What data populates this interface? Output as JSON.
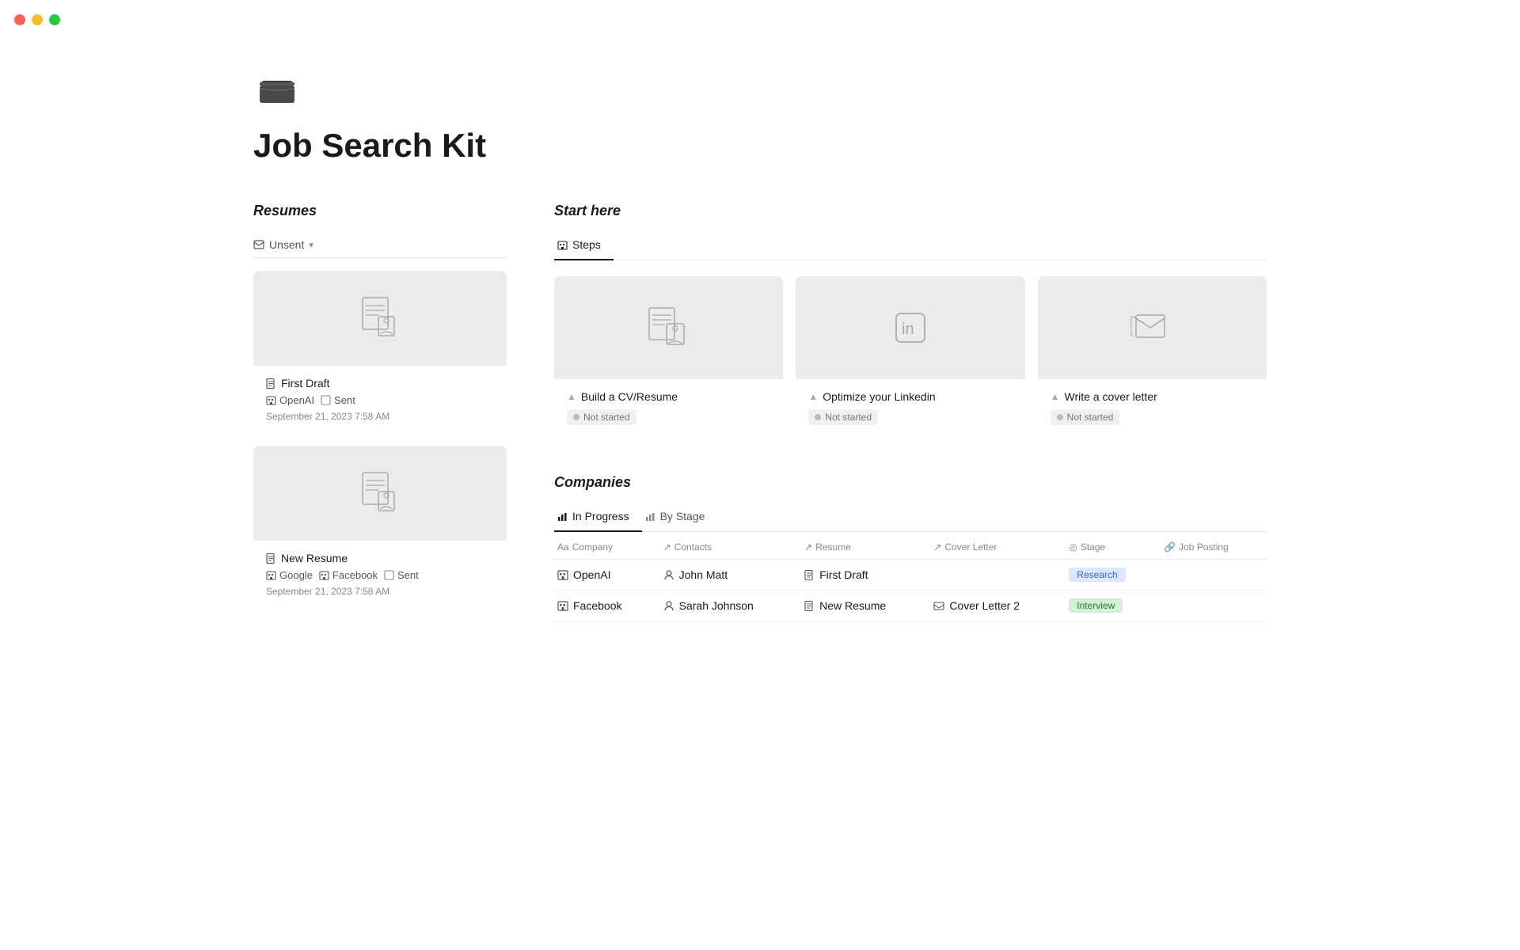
{
  "trafficLights": {
    "red": "#ff5f57",
    "yellow": "#febc2e",
    "green": "#28c840"
  },
  "page": {
    "title": "Job Search Kit"
  },
  "resumes": {
    "sectionHeader": "Resumes",
    "filter": {
      "label": "Unsent",
      "icon": "envelope-icon"
    },
    "cards": [
      {
        "title": "First Draft",
        "metaItems": [
          "OpenAI"
        ],
        "sent": "Sent",
        "date": "September 21, 2023 7:58 AM"
      },
      {
        "title": "New Resume",
        "metaItems": [
          "Google",
          "Facebook"
        ],
        "sent": "Sent",
        "date": "September 21, 2023 7:58 AM"
      }
    ]
  },
  "startHere": {
    "sectionHeader": "Start here",
    "tabs": [
      {
        "label": "Steps",
        "active": true
      }
    ],
    "steps": [
      {
        "title": "Build a CV/Resume",
        "status": "Not started"
      },
      {
        "title": "Optimize your Linkedin",
        "status": "Not started"
      },
      {
        "title": "Write a cover letter",
        "status": "Not started"
      }
    ]
  },
  "companies": {
    "sectionHeader": "Companies",
    "views": [
      {
        "label": "In Progress",
        "active": true
      },
      {
        "label": "By Stage",
        "active": false
      }
    ],
    "columns": [
      {
        "label": "Company",
        "prefix": "Aa"
      },
      {
        "label": "Contacts",
        "prefix": "↗"
      },
      {
        "label": "Resume",
        "prefix": "↗"
      },
      {
        "label": "Cover Letter",
        "prefix": "↗"
      },
      {
        "label": "Stage",
        "prefix": "◎"
      },
      {
        "label": "Job Posting",
        "prefix": "🔗"
      }
    ],
    "rows": [
      {
        "company": "OpenAI",
        "contacts": "John Matt",
        "resume": "First Draft",
        "coverLetter": "",
        "stage": "Research",
        "stageClass": "stage-research",
        "jobPosting": ""
      },
      {
        "company": "Facebook",
        "contacts": "Sarah Johnson",
        "resume": "New Resume",
        "coverLetter": "Cover Letter 2",
        "stage": "Interview",
        "stageClass": "stage-interview",
        "jobPosting": ""
      }
    ]
  }
}
